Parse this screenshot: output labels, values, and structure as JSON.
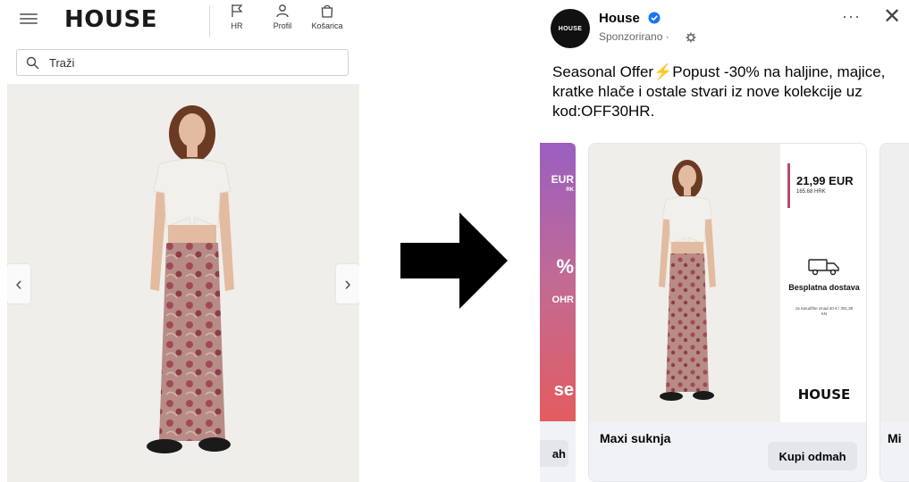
{
  "store": {
    "logo": "HOUSE",
    "nav": {
      "language": "HR",
      "profile": "Profil",
      "cart": "Košarica"
    },
    "search": {
      "placeholder": "Traži"
    }
  },
  "ad": {
    "avatar_text": "HOUSE",
    "page_name": "House",
    "sponsored": "Sponzorirano ·",
    "more": "···",
    "close": "✕",
    "text": "Seasonal Offer⚡Popust -30% na haljine, majice, kratke hlače i ostale stvari iz nove kolekcije uz kod:OFF30HR.",
    "prev_card": {
      "lines": [
        "EUR",
        "RK",
        "%",
        "OHR",
        "se"
      ],
      "cta": "ah"
    },
    "card": {
      "price": "21,99 EUR",
      "price_hrk": "165.68 HRK",
      "shipping_title": "Besplatna dostava",
      "shipping_sub": "za narudžbe iznad 40 € / 301,38 KN",
      "logo": "HOUSE",
      "product_name": "Maxi suknja",
      "cta": "Kupi odmah"
    },
    "next_card": {
      "label": "Mi"
    }
  },
  "colors": {
    "accent_verified": "#1877f2",
    "price_bar": "#b54a6f",
    "skirt": "#b88c86",
    "top": "#f2f0ea"
  }
}
